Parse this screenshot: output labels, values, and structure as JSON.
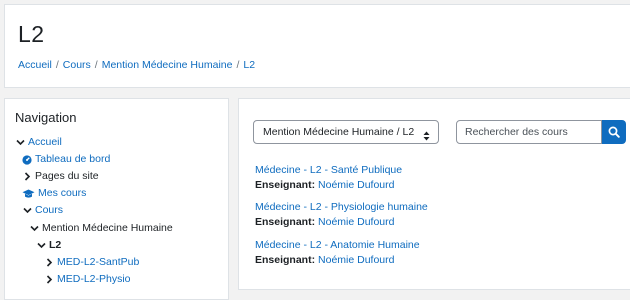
{
  "page": {
    "title": "L2",
    "breadcrumb": [
      "Accueil",
      "Cours",
      "Mention Médecine Humaine",
      "L2"
    ],
    "breadcrumb_separator": "/"
  },
  "navigation": {
    "title": "Navigation",
    "items": [
      {
        "label": "Accueil",
        "icon": "chevron-down-icon"
      },
      {
        "label": "Tableau de bord",
        "icon": "dashboard-icon"
      },
      {
        "label": "Pages du site",
        "icon": "chevron-right-icon"
      },
      {
        "label": "Mes cours",
        "icon": "graduation-cap-icon"
      },
      {
        "label": "Cours",
        "icon": "chevron-down-icon"
      },
      {
        "label": "Mention Médecine Humaine",
        "icon": "chevron-down-icon"
      },
      {
        "label": "L2",
        "icon": "chevron-down-icon"
      },
      {
        "label": "MED-L2-SantPub",
        "icon": "chevron-right-icon"
      },
      {
        "label": "MED-L2-Physio",
        "icon": "chevron-right-icon"
      }
    ]
  },
  "main": {
    "category_select": "Mention Médecine Humaine / L2",
    "search": {
      "placeholder": "Rechercher des cours",
      "value": ""
    },
    "teacher_label": "Enseignant:",
    "courses": [
      {
        "name": "Médecine - L2 - Santé Publique",
        "teacher": "Noémie Dufourd"
      },
      {
        "name": "Médecine - L2 - Physiologie humaine",
        "teacher": "Noémie Dufourd"
      },
      {
        "name": "Médecine - L2 - Anatomie Humaine",
        "teacher": "Noémie Dufourd"
      }
    ]
  },
  "colors": {
    "link": "#0f6cbf",
    "accent": "#0f6cbf",
    "text": "#1d2125",
    "background": "#f2f2f2"
  }
}
